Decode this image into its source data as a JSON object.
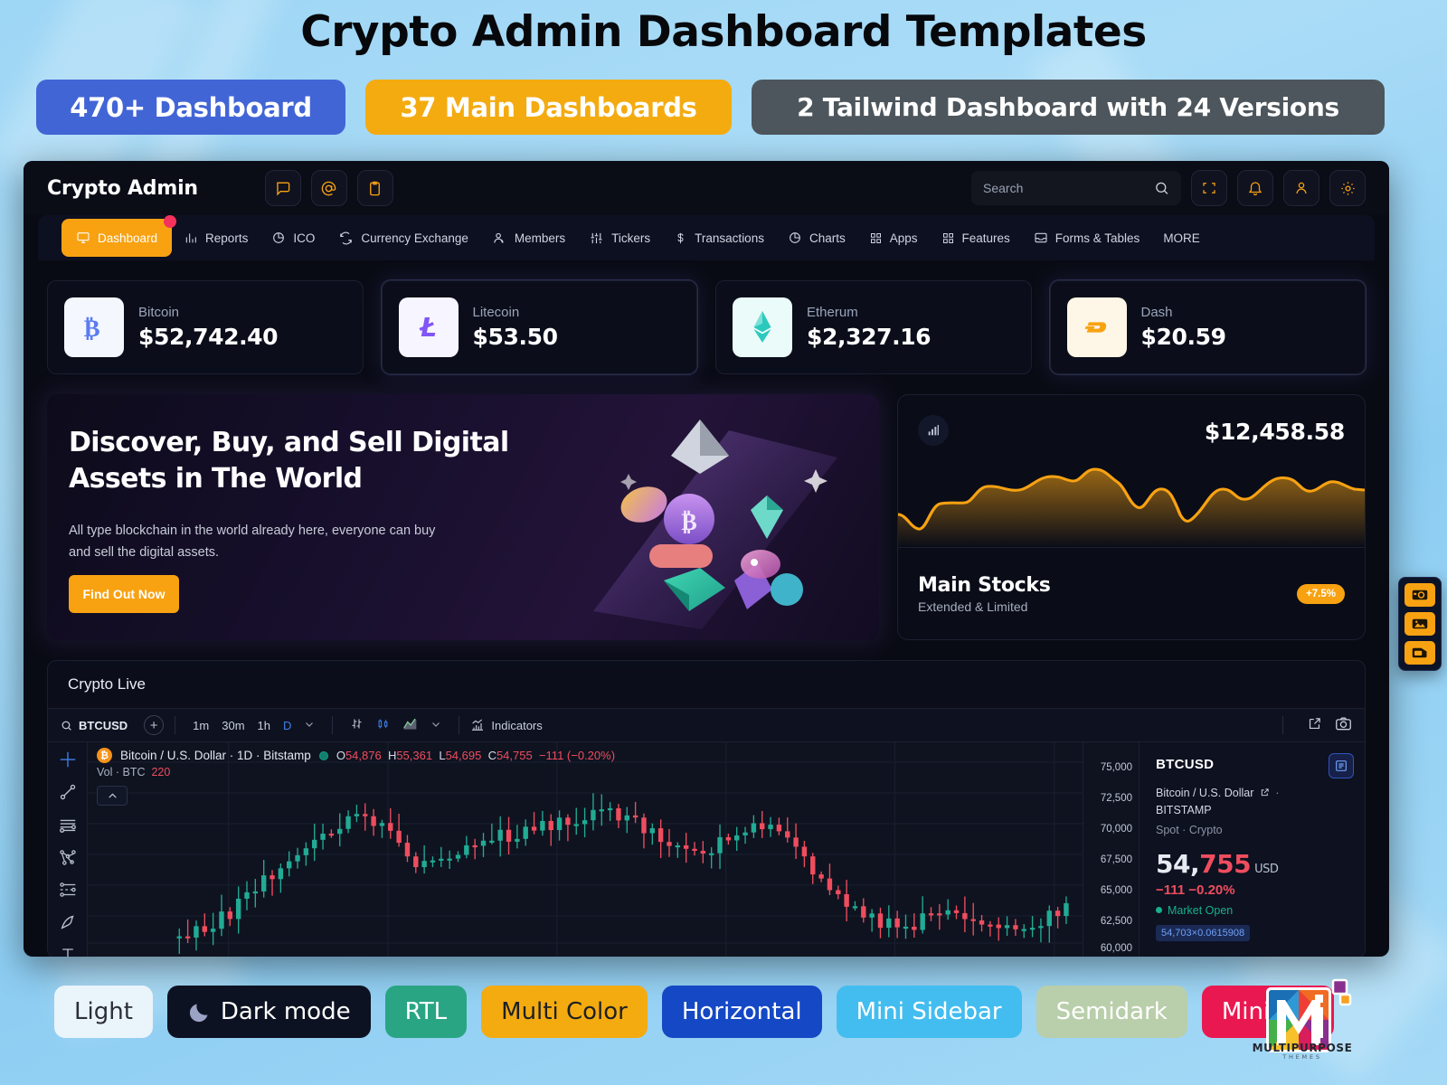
{
  "promo": {
    "title": "Crypto Admin Dashboard Templates",
    "pills": [
      {
        "label": "470+ Dashboard",
        "color": "#4265d6"
      },
      {
        "label": "37 Main Dashboards",
        "color": "#f4ab10"
      },
      {
        "label": "2 Tailwind Dashboard with 24 Versions",
        "color": "#4d565c"
      }
    ]
  },
  "app": {
    "brand": "Crypto Admin",
    "top_icons": [
      "chat-icon",
      "mention-icon",
      "clipboard-icon"
    ],
    "search": {
      "placeholder": "Search",
      "value": "",
      "icon": "search-icon"
    },
    "top_actions": [
      "fullscreen-icon",
      "bell-icon",
      "user-icon",
      "gear-icon"
    ],
    "nav": [
      {
        "label": "Dashboard",
        "icon": "monitor-icon",
        "active": true,
        "badge": true
      },
      {
        "label": "Reports",
        "icon": "bar-chart-icon",
        "active": false
      },
      {
        "label": "ICO",
        "icon": "pie-chart-icon",
        "active": false
      },
      {
        "label": "Currency Exchange",
        "icon": "exchange-icon",
        "active": false
      },
      {
        "label": "Members",
        "icon": "users-icon",
        "active": false
      },
      {
        "label": "Tickers",
        "icon": "sliders-icon",
        "active": false
      },
      {
        "label": "Transactions",
        "icon": "dollar-icon",
        "active": false
      },
      {
        "label": "Charts",
        "icon": "pie-chart-icon",
        "active": false
      },
      {
        "label": "Apps",
        "icon": "grid-icon",
        "active": false
      },
      {
        "label": "Features",
        "icon": "grid-icon",
        "active": false
      },
      {
        "label": "Forms & Tables",
        "icon": "inbox-icon",
        "active": false
      },
      {
        "label": "MORE",
        "icon": "",
        "active": false
      }
    ]
  },
  "coins": [
    {
      "name": "Bitcoin",
      "price": "$52,742.40",
      "glyph": "₿",
      "fg": "#5b7cf0",
      "bg": "#f4f7fe"
    },
    {
      "name": "Litecoin",
      "price": "$53.50",
      "glyph": "Ł",
      "fg": "#8155f6",
      "bg": "#f7f5ff"
    },
    {
      "name": "Etherum",
      "price": "$2,327.16",
      "glyph": "◆",
      "fg": "#22c9bb",
      "bg": "#eafbf9"
    },
    {
      "name": "Dash",
      "price": "$20.59",
      "glyph": "D",
      "fg": "#f8a212",
      "bg": "#fef6e6"
    }
  ],
  "hero": {
    "heading": "Discover, Buy, and Sell Digital Assets in The World",
    "paragraph": "All type blockchain in the world already here, everyone can buy and sell the digital assets.",
    "cta": "Find Out Now"
  },
  "stocks": {
    "amount": "$12,458.58",
    "title": "Main Stocks",
    "subtitle": "Extended & Limited",
    "change_chip": "+7.5%",
    "icon": "bar-chart-icon",
    "accent": "#f8a212"
  },
  "live": {
    "panel_title": "Crypto Live",
    "toolbar": {
      "symbol": "BTCUSD",
      "search_icon": "search-icon",
      "add_icon": "plus-icon",
      "resolutions": [
        "1m",
        "30m",
        "1h",
        "D"
      ],
      "active_resolution": "D",
      "indicators_label": "Indicators",
      "right_icons": [
        "external-link-icon",
        "camera-icon"
      ]
    },
    "left_tools": [
      "crosshair-icon",
      "trend-line-icon",
      "horizontal-lines-icon",
      "pitchfork-icon",
      "patterns-icon",
      "brush-icon",
      "text-icon"
    ],
    "legend": {
      "symbol_title": "Bitcoin / U.S. Dollar · 1D · Bitstamp",
      "status": "market-open-dot",
      "open_label": "O",
      "open": "54,876",
      "high_label": "H",
      "high": "55,361",
      "low_label": "L",
      "low": "54,695",
      "close_label": "C",
      "close": "54,755",
      "delta": "−111 (−0.20%)",
      "volume_label": "Vol · BTC",
      "volume": "220"
    },
    "sidebar": {
      "symbol": "BTCUSD",
      "description": "Bitcoin / U.S. Dollar",
      "exchange": "BITSTAMP",
      "meta": "Spot · Crypto",
      "price_whole": "54,",
      "price_frac": "755",
      "currency": "USD",
      "change": "−111  −0.20%",
      "market_status": "Market Open",
      "quote_tag": "54,703×0.0615908",
      "list_icon": "list-icon"
    }
  },
  "dock": [
    "camera-icon",
    "image-icon",
    "note-icon"
  ],
  "themes": [
    {
      "label": "Light",
      "icon": ""
    },
    {
      "label": "Dark mode",
      "icon": "moon-icon"
    },
    {
      "label": "RTL",
      "icon": ""
    },
    {
      "label": "Multi Color",
      "icon": ""
    },
    {
      "label": "Horizontal",
      "icon": ""
    },
    {
      "label": "Mini Sidebar",
      "icon": ""
    },
    {
      "label": "Semidark",
      "icon": ""
    },
    {
      "label": "Minimal",
      "icon": ""
    }
  ],
  "footer_logo": {
    "word": "MULTIPURPOSE",
    "sub": "THEMES"
  },
  "chart_data": {
    "type": "line",
    "title": "Main Stocks sparkline",
    "series": [
      {
        "name": "Main Stocks",
        "values": [
          22,
          10,
          33,
          34,
          36,
          44,
          45,
          40,
          52,
          50,
          48,
          56,
          51,
          43,
          40,
          26,
          33,
          47,
          38,
          33,
          42,
          52,
          46,
          48,
          55,
          50,
          44,
          48
        ]
      }
    ],
    "ylim": [
      0,
      60
    ],
    "grid": false,
    "legend_position": "none"
  }
}
